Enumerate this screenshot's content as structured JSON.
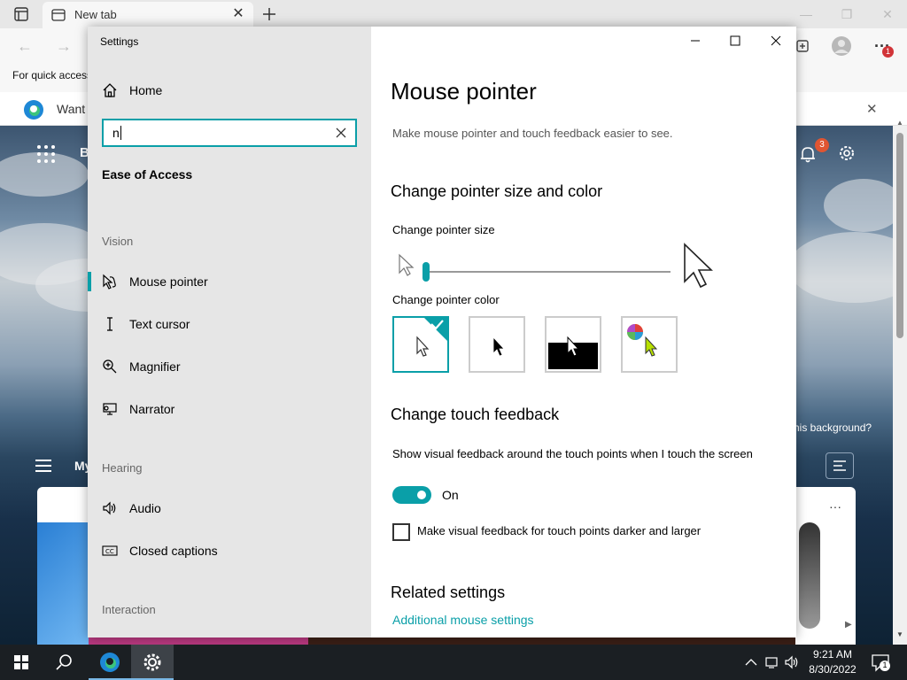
{
  "browser": {
    "tab_title": "New tab",
    "favorites_bar_text": "For quick access",
    "infobar_text": "Want",
    "ntp_brand_partial": "B",
    "ntp_notification_count": "3",
    "ntp_background_question": "his background?",
    "ntp_section_partial": "My",
    "profile_notification_count": "1",
    "accent_color": "#0a9fa8"
  },
  "settings": {
    "app_title": "Settings",
    "nav": {
      "home": "Home",
      "search_value": "n",
      "category": "Ease of Access",
      "groups": {
        "vision": "Vision",
        "hearing": "Hearing",
        "interaction": "Interaction"
      },
      "items": [
        {
          "label": "Mouse pointer",
          "icon": "mouse-pointer-icon",
          "active": true
        },
        {
          "label": "Text cursor",
          "icon": "text-cursor-icon"
        },
        {
          "label": "Magnifier",
          "icon": "magnifier-icon"
        },
        {
          "label": "Narrator",
          "icon": "narrator-icon"
        },
        {
          "label": "Audio",
          "icon": "speaker-icon"
        },
        {
          "label": "Closed captions",
          "icon": "closed-captions-icon"
        }
      ]
    },
    "main": {
      "title": "Mouse pointer",
      "description": "Make mouse pointer and touch feedback easier to see.",
      "size_color_heading": "Change pointer size and color",
      "pointer_size_label": "Change pointer size",
      "pointer_size_value": 1,
      "pointer_color_label": "Change pointer color",
      "color_options": [
        "white",
        "black",
        "inverted",
        "custom"
      ],
      "selected_color": "white",
      "touch_heading": "Change touch feedback",
      "touch_description": "Show visual feedback around the touch points when I touch the screen",
      "touch_toggle_state": "On",
      "darker_checkbox_label": "Make visual feedback for touch points darker and larger",
      "darker_checkbox_checked": false,
      "related_heading": "Related settings",
      "related_link": "Additional mouse settings"
    }
  },
  "taskbar": {
    "time": "9:21 AM",
    "date": "8/30/2022",
    "notification_count": "1"
  }
}
